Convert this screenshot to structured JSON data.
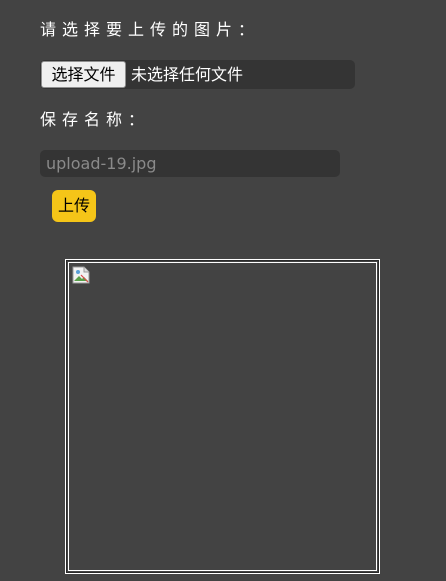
{
  "upload_form": {
    "select_image_label": "请选择要上传的图片：",
    "file_button_label": "选择文件",
    "file_status": "未选择任何文件",
    "save_name_label": "保存名称：",
    "save_name_placeholder": "upload-19.jpg",
    "upload_button_label": "上传"
  },
  "preview": {
    "image_state": "broken-image",
    "broken_icon": "broken-image-icon"
  },
  "colors": {
    "page_background": "#434343",
    "field_background": "#343434",
    "upload_button": "#f5c518",
    "text": "#ffffff",
    "placeholder_text": "#8a8a8a"
  }
}
